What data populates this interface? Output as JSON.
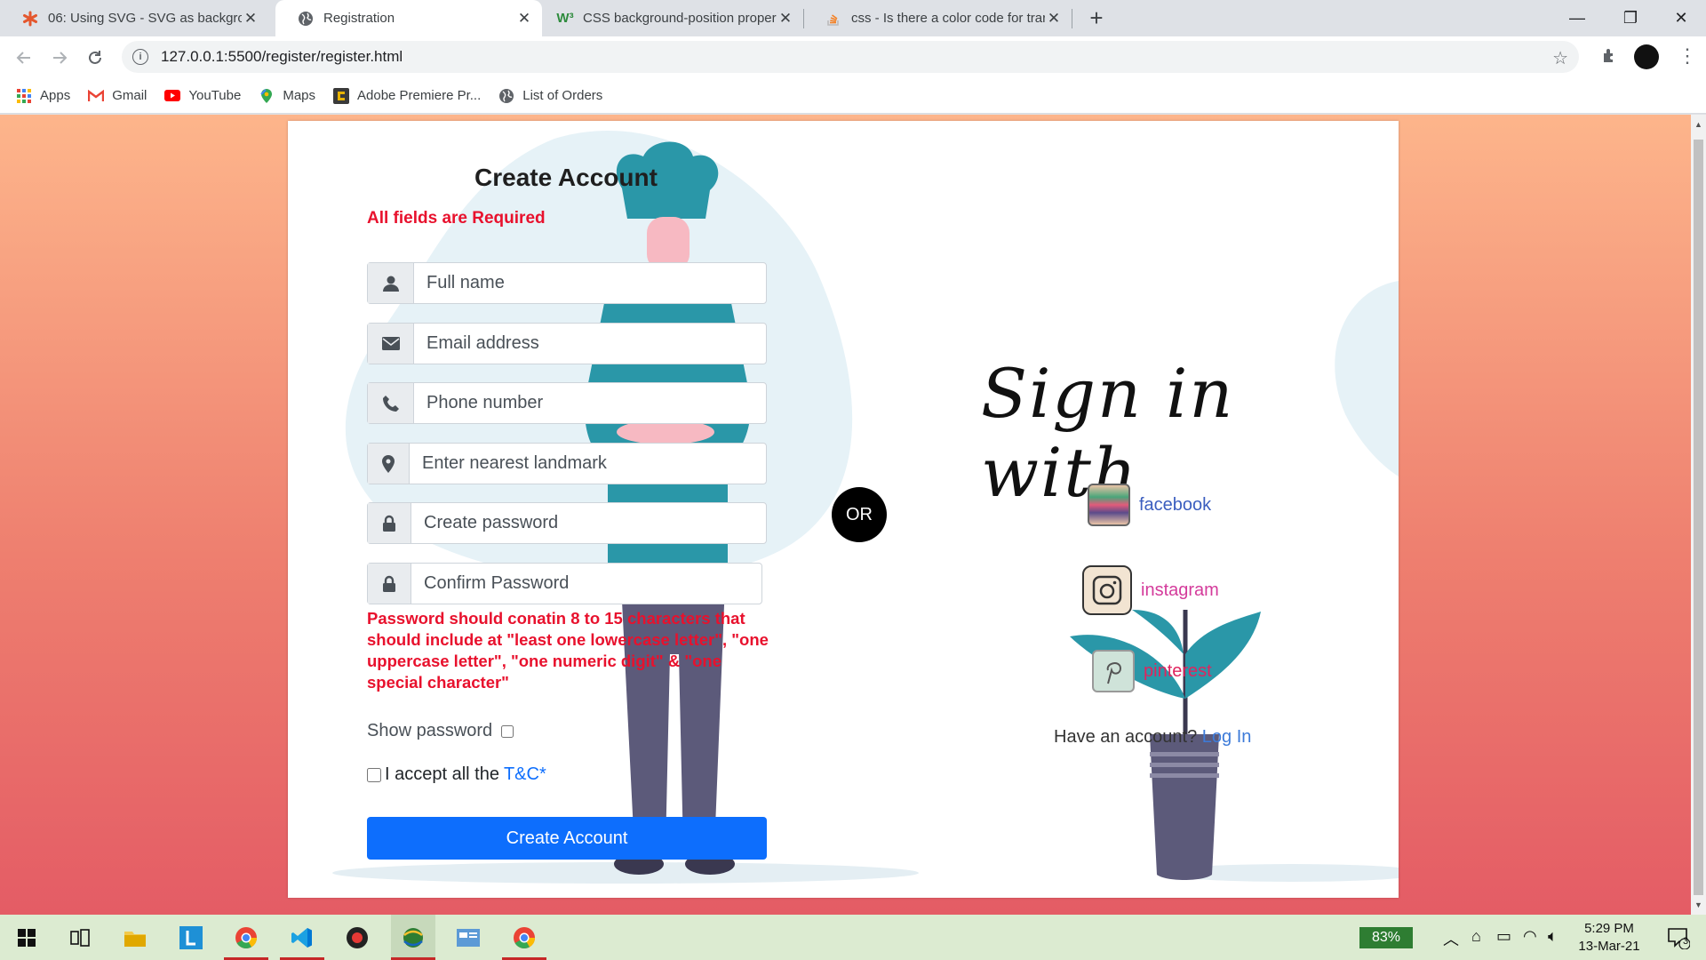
{
  "browser": {
    "tabs": [
      {
        "title": "06: Using SVG - SVG as backgrou",
        "active": false,
        "favicon": "asterisk-icon"
      },
      {
        "title": "Registration",
        "active": true,
        "favicon": "globe-icon"
      },
      {
        "title": "CSS background-position proper",
        "active": false,
        "favicon": "w3-icon"
      },
      {
        "title": "css - Is there a color code for trar",
        "active": false,
        "favicon": "stackoverflow-icon"
      }
    ],
    "url": "127.0.0.1:5500/register/register.html",
    "bookmarks": [
      {
        "label": "Apps",
        "icon": "apps-grid-icon"
      },
      {
        "label": "Gmail",
        "icon": "gmail-icon"
      },
      {
        "label": "YouTube",
        "icon": "youtube-icon"
      },
      {
        "label": "Maps",
        "icon": "maps-icon"
      },
      {
        "label": "Adobe Premiere Pr...",
        "icon": "adobe-icon"
      },
      {
        "label": "List of Orders",
        "icon": "globe-icon"
      }
    ]
  },
  "form": {
    "title": "Create Account",
    "required_note": "All fields are Required",
    "fields": [
      {
        "placeholder": "Full name",
        "icon": "user-icon"
      },
      {
        "placeholder": "Email address",
        "icon": "envelope-icon"
      },
      {
        "placeholder": "Phone number",
        "icon": "phone-icon"
      },
      {
        "placeholder": "Enter nearest landmark",
        "icon": "map-marker-icon"
      },
      {
        "placeholder": "Create password",
        "icon": "lock-icon"
      },
      {
        "placeholder": "Confirm Password",
        "icon": "lock-icon"
      }
    ],
    "password_rule": "Password should conatin 8 to 15 characters that should include at \"least one lowercase letter\", \"one uppercase letter\", \"one numeric digit\" & \"one special character\"",
    "show_password_label": "Show password",
    "accept_label": "I accept all the",
    "tc_link": "T&C*",
    "submit_label": "Create Account"
  },
  "or_label": "OR",
  "signin": {
    "title": "Sign in with",
    "providers": [
      {
        "label": "facebook",
        "color": "#3b5ebf"
      },
      {
        "label": "instagram",
        "color": "#d43b9b"
      },
      {
        "label": "pinterest",
        "color": "#e0245e"
      }
    ],
    "have_account": "Have an account?",
    "login_link": "Log In"
  },
  "taskbar": {
    "battery": "83%",
    "time": "5:29 PM",
    "date": "13-Mar-21",
    "notifications": "3"
  },
  "colors": {
    "accent": "#0d6efd",
    "error": "#e8112d",
    "teal": "#2a97a8"
  }
}
